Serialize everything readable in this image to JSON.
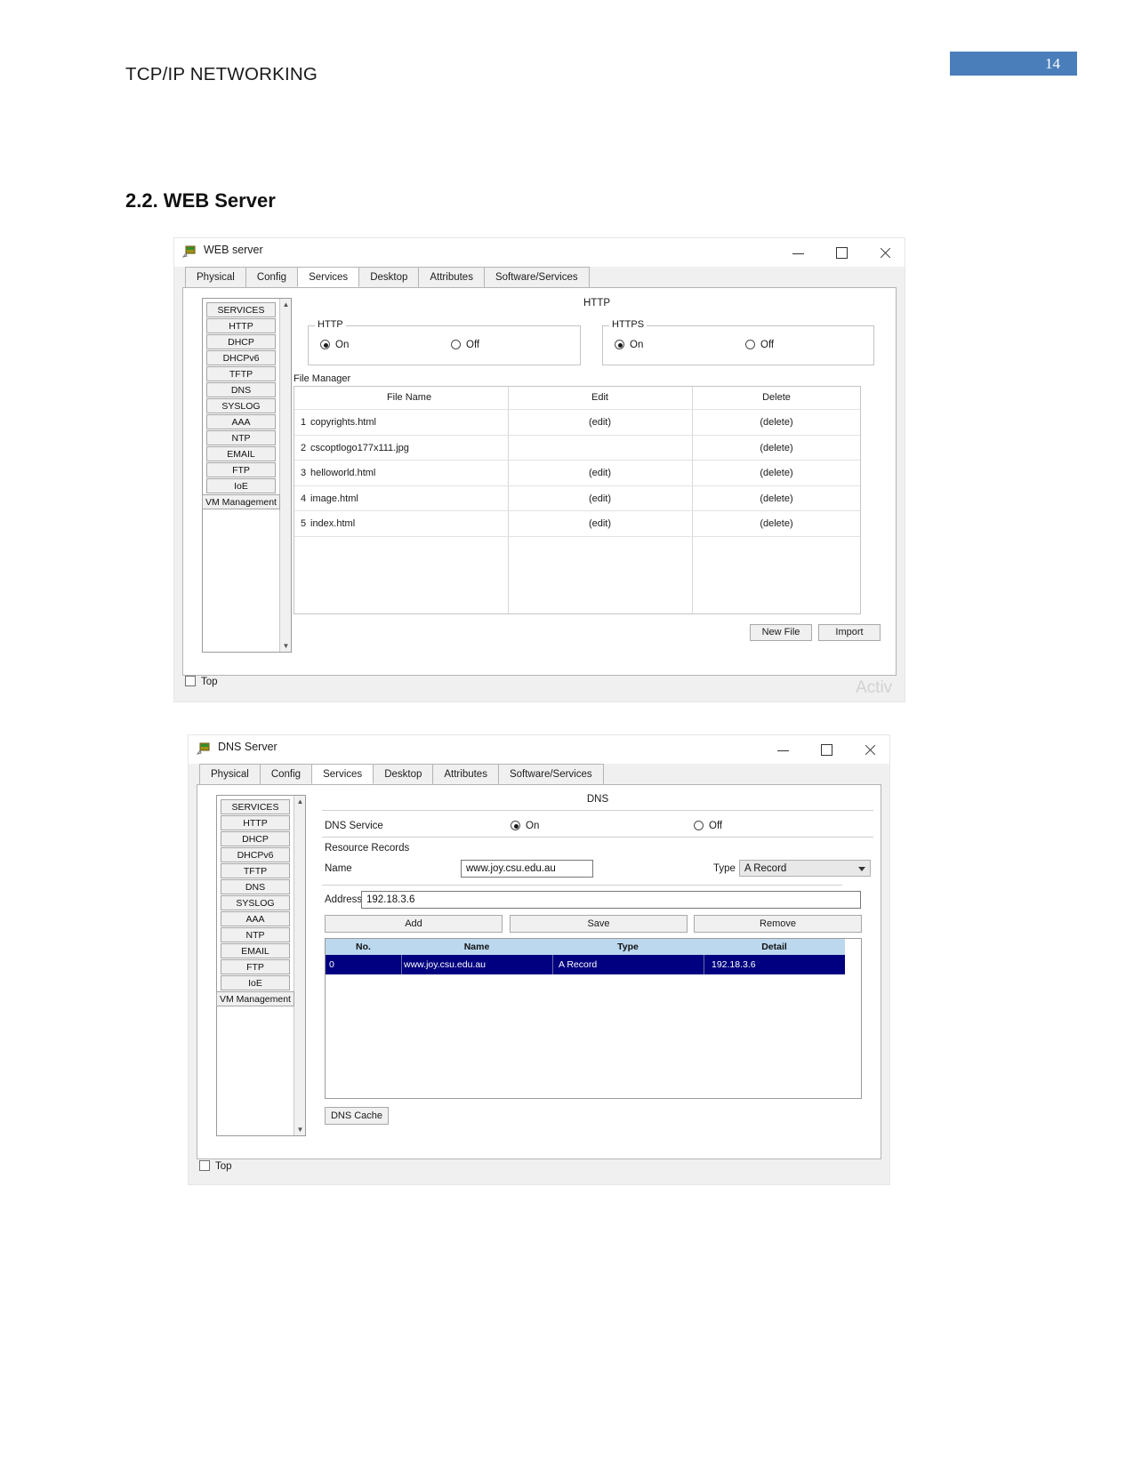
{
  "document": {
    "header_title": "TCP/IP NETWORKING",
    "page_number": "14",
    "page_badge_color": "#4a7ebb",
    "section_heading": "2.2. WEB Server"
  },
  "web_window": {
    "title": "WEB server",
    "app_icon": "packet-tracer-device-icon",
    "window_buttons": {
      "minimize": "minimize-icon",
      "maximize": "maximize-icon",
      "close": "close-icon"
    },
    "tabs": [
      {
        "label": "Physical",
        "active": false
      },
      {
        "label": "Config",
        "active": false
      },
      {
        "label": "Services",
        "active": true
      },
      {
        "label": "Desktop",
        "active": false
      },
      {
        "label": "Attributes",
        "active": false
      },
      {
        "label": "Software/Services",
        "active": false
      }
    ],
    "services_list": [
      "SERVICES",
      "HTTP",
      "DHCP",
      "DHCPv6",
      "TFTP",
      "DNS",
      "SYSLOG",
      "AAA",
      "NTP",
      "EMAIL",
      "FTP",
      "IoE",
      "VM Management"
    ],
    "panel_title": "HTTP",
    "http_group": {
      "legend": "HTTP",
      "on_label": "On",
      "off_label": "Off",
      "selected": "On"
    },
    "https_group": {
      "legend": "HTTPS",
      "on_label": "On",
      "off_label": "Off",
      "selected": "On"
    },
    "file_manager": {
      "legend": "File Manager",
      "columns": [
        "File Name",
        "Edit",
        "Delete"
      ],
      "rows": [
        {
          "no": "1",
          "name": "copyrights.html",
          "edit": "(edit)",
          "delete": "(delete)"
        },
        {
          "no": "2",
          "name": "cscoptlogo177x111.jpg",
          "edit": "",
          "delete": "(delete)"
        },
        {
          "no": "3",
          "name": "helloworld.html",
          "edit": "(edit)",
          "delete": "(delete)"
        },
        {
          "no": "4",
          "name": "image.html",
          "edit": "(edit)",
          "delete": "(delete)"
        },
        {
          "no": "5",
          "name": "index.html",
          "edit": "(edit)",
          "delete": "(delete)"
        }
      ]
    },
    "new_file_button": "New File",
    "import_button": "Import",
    "top_checkbox_label": "Top",
    "watermark": "Activ"
  },
  "dns_window": {
    "title": "DNS Server",
    "app_icon": "packet-tracer-device-icon",
    "window_buttons": {
      "minimize": "minimize-icon",
      "maximize": "maximize-icon",
      "close": "close-icon"
    },
    "tabs": [
      {
        "label": "Physical",
        "active": false
      },
      {
        "label": "Config",
        "active": false
      },
      {
        "label": "Services",
        "active": true
      },
      {
        "label": "Desktop",
        "active": false
      },
      {
        "label": "Attributes",
        "active": false
      },
      {
        "label": "Software/Services",
        "active": false
      }
    ],
    "services_list": [
      "SERVICES",
      "HTTP",
      "DHCP",
      "DHCPv6",
      "TFTP",
      "DNS",
      "SYSLOG",
      "AAA",
      "NTP",
      "EMAIL",
      "FTP",
      "IoE",
      "VM Management"
    ],
    "panel_title": "DNS",
    "dns_service": {
      "label": "DNS Service",
      "on_label": "On",
      "off_label": "Off",
      "selected": "On"
    },
    "resource_records": {
      "legend": "Resource Records",
      "name_label": "Name",
      "name_value": "www.joy.csu.edu.au",
      "type_label": "Type",
      "type_value": "A Record",
      "address_label": "Address",
      "address_value": "192.18.3.6",
      "add_button": "Add",
      "save_button": "Save",
      "remove_button": "Remove",
      "columns": [
        "No.",
        "Name",
        "Type",
        "Detail"
      ],
      "rows": [
        {
          "no": "0",
          "name": "www.joy.csu.edu.au",
          "type": "A Record",
          "detail": "192.18.3.6"
        }
      ],
      "header_bg": "#bcd8ef",
      "selected_row_bg": "#000080"
    },
    "dns_cache_button": "DNS Cache",
    "top_checkbox_label": "Top"
  }
}
